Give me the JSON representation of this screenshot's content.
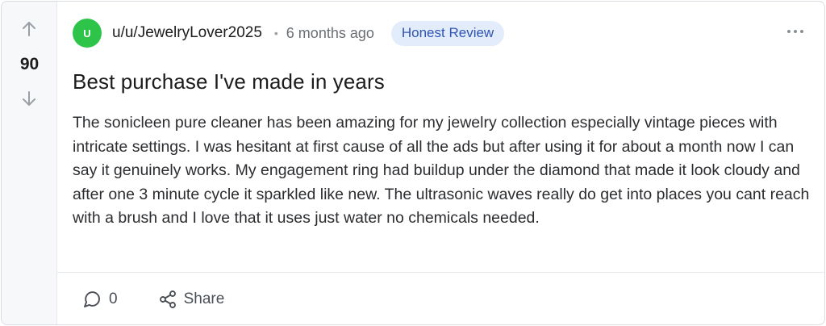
{
  "post": {
    "votes": {
      "count": "90",
      "upvote_icon": "arrow-up-icon",
      "downvote_icon": "arrow-down-icon"
    },
    "author": {
      "avatar_letter": "U",
      "avatar_color": "#2ec44a",
      "username": "u/u/JewelryLover2025"
    },
    "separator": "•",
    "timestamp": "6 months ago",
    "flair": {
      "label": "Honest Review",
      "background": "#e3ecfb",
      "color": "#2f55b0"
    },
    "more_icon": "more-horizontal-icon",
    "title": "Best purchase I've made in years",
    "body": "The sonicleen pure cleaner has been amazing for my jewelry collection especially vintage pieces with intricate settings. I was hesitant at first cause of all the ads but after using it for about a month now I can say it genuinely works. My engagement ring had buildup under the diamond that made it look cloudy and after one 3 minute cycle it sparkled like new. The ultrasonic waves really do get into places you cant reach with a brush and I love that it uses just water no chemicals needed.",
    "actions": {
      "comments": {
        "icon": "comment-icon",
        "count": "0"
      },
      "share": {
        "icon": "share-icon",
        "label": "Share"
      }
    }
  }
}
